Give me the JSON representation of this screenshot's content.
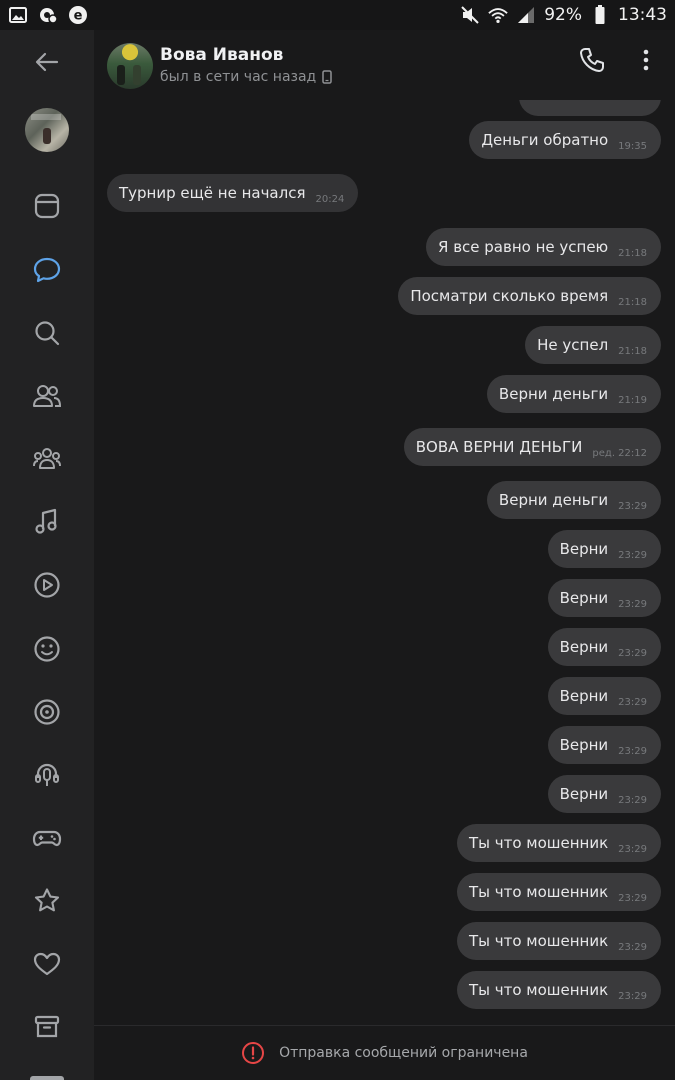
{
  "status_bar": {
    "battery": "92%",
    "time": "13:43",
    "left_icons": [
      "image-icon",
      "notification-icon",
      "browser-icon"
    ],
    "right_icons": [
      "mute-icon",
      "wifi-icon",
      "signal-icon"
    ]
  },
  "rail": {
    "items": [
      {
        "name": "back-icon"
      },
      {
        "name": "profile-avatar"
      },
      {
        "name": "news-icon"
      },
      {
        "name": "messages-icon",
        "active": true
      },
      {
        "name": "search-icon"
      },
      {
        "name": "friends-icon"
      },
      {
        "name": "communities-icon"
      },
      {
        "name": "music-icon"
      },
      {
        "name": "video-icon"
      },
      {
        "name": "stickers-icon"
      },
      {
        "name": "clips-icon"
      },
      {
        "name": "podcasts-icon"
      },
      {
        "name": "games-icon"
      },
      {
        "name": "bookmarks-icon"
      },
      {
        "name": "likes-icon"
      },
      {
        "name": "archive-icon"
      }
    ],
    "accent": "#5ea3e8",
    "icon_color": "#a3a5a8"
  },
  "header": {
    "name": "Вова Иванов",
    "status": "был в сети час назад"
  },
  "messages": [
    {
      "text": "Деньги обратно",
      "time": "19:35",
      "dir": "out"
    },
    {
      "text": "Турнир ещё не начался",
      "time": "20:24",
      "dir": "in"
    },
    {
      "text": "Я все равно не успею",
      "time": "21:18",
      "dir": "out"
    },
    {
      "text": "Посматри сколько время",
      "time": "21:18",
      "dir": "out"
    },
    {
      "text": "Не успел",
      "time": "21:18",
      "dir": "out"
    },
    {
      "text": "Верни деньги",
      "time": "21:19",
      "dir": "out"
    },
    {
      "text": "ВОВА ВЕРНИ ДЕНЬГИ",
      "time": "ред. 22:12",
      "dir": "out"
    },
    {
      "text": "Верни деньги",
      "time": "23:29",
      "dir": "out"
    },
    {
      "text": "Верни",
      "time": "23:29",
      "dir": "out"
    },
    {
      "text": "Верни",
      "time": "23:29",
      "dir": "out"
    },
    {
      "text": "Верни",
      "time": "23:29",
      "dir": "out"
    },
    {
      "text": "Верни",
      "time": "23:29",
      "dir": "out"
    },
    {
      "text": "Верни",
      "time": "23:29",
      "dir": "out"
    },
    {
      "text": "Верни",
      "time": "23:29",
      "dir": "out"
    },
    {
      "text": "Ты что мошенник",
      "time": "23:29",
      "dir": "out"
    },
    {
      "text": "Ты что мошенник",
      "time": "23:29",
      "dir": "out"
    },
    {
      "text": "Ты что мошенник",
      "time": "23:29",
      "dir": "out"
    },
    {
      "text": "Ты что мошенник",
      "time": "23:29",
      "dir": "out"
    }
  ],
  "footer": {
    "notice": "Отправка сообщений ограничена",
    "warn_color": "#e64646"
  }
}
